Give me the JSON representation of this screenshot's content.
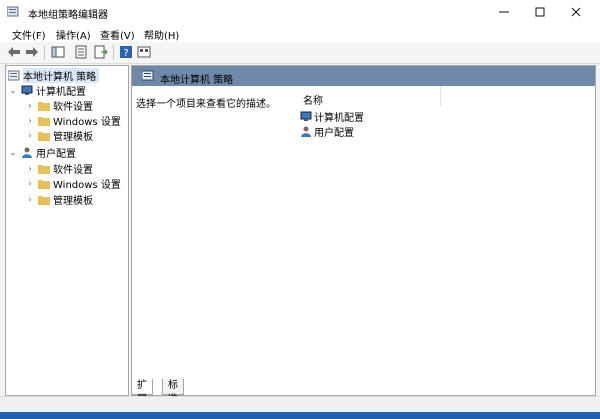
{
  "window": {
    "title": "本地组策略编辑器"
  },
  "menu": [
    "文件(F)",
    "操作(A)",
    "查看(V)",
    "帮助(H)"
  ],
  "tree": {
    "root": "本地计算机 策略",
    "computer": {
      "label": "计算机配置",
      "children": [
        "软件设置",
        "Windows 设置",
        "管理模板"
      ]
    },
    "user": {
      "label": "用户配置",
      "children": [
        "软件设置",
        "Windows 设置",
        "管理模板"
      ]
    }
  },
  "right": {
    "header": "本地计算机 策略",
    "description": "选择一个项目来查看它的描述。",
    "column_name": "名称",
    "items": [
      "计算机配置",
      "用户配置"
    ]
  },
  "tabs": [
    "扩展",
    "标准"
  ],
  "colors": {
    "accent_header": "#6f89a8",
    "folder": "#e8c15a",
    "desktop_bg": "#1f5fae"
  }
}
